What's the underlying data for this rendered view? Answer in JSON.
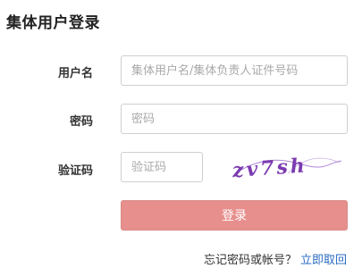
{
  "title": "集体用户登录",
  "form": {
    "username_label": "用户名",
    "username_placeholder": "集体用户名/集体负责人证件号码",
    "password_label": "密码",
    "password_placeholder": "密码",
    "captcha_label": "验证码",
    "captcha_placeholder": "验证码",
    "captcha_text": "zv7sh",
    "captcha_color": "#7b3bb0",
    "login_label": "登录",
    "login_color": "#e68f8d"
  },
  "footer": {
    "forgot_text": "忘记密码或帐号？",
    "recover_link": "立即取回",
    "link_color": "#2a6cc0"
  }
}
